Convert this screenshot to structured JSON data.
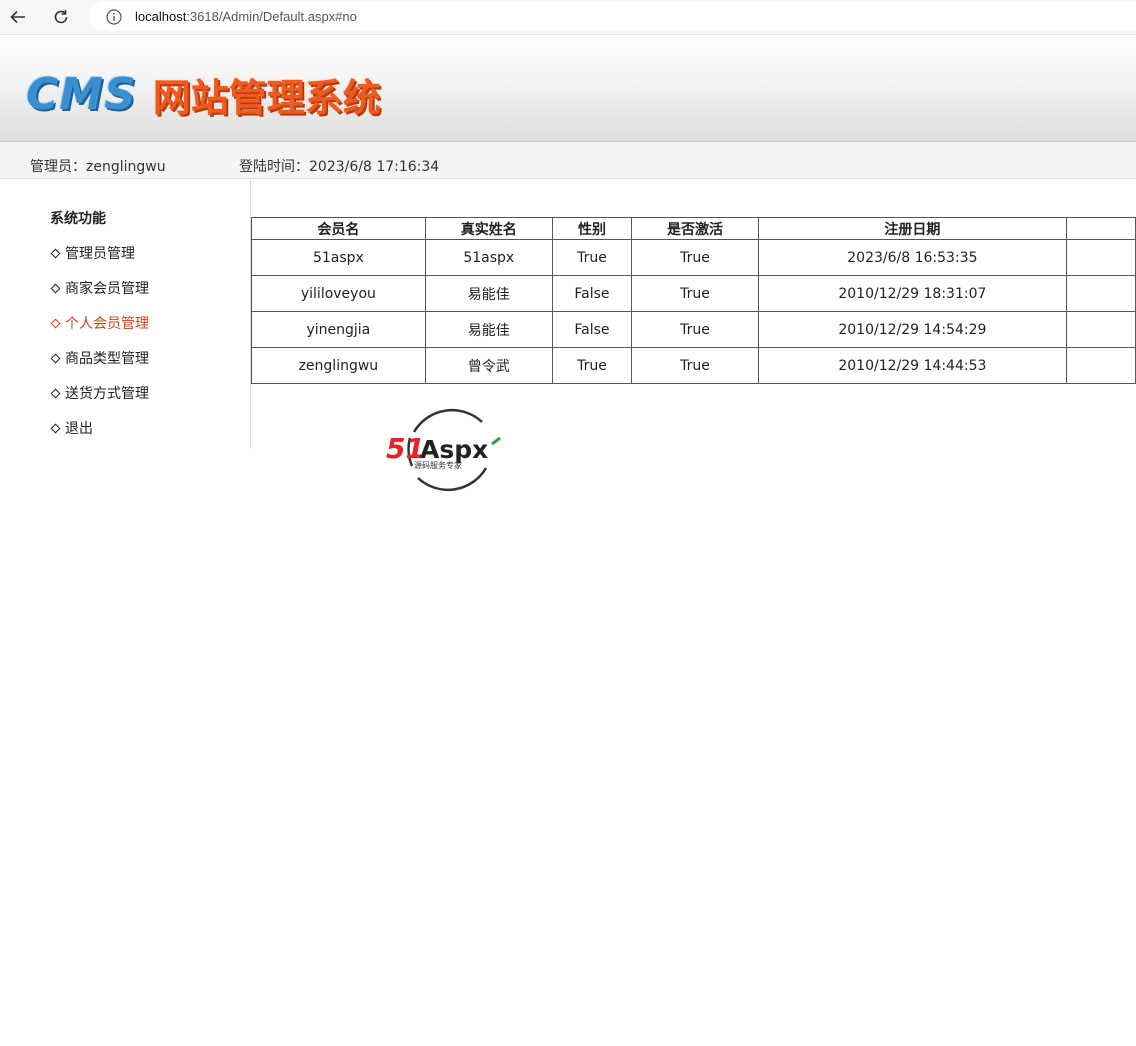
{
  "browser": {
    "url_host": "localhost",
    "url_rest": ":3618/Admin/Default.aspx#no"
  },
  "header": {
    "logo_cms": "CMS",
    "logo_title": "网站管理系统"
  },
  "infobar": {
    "admin": "管理员：zenglingwu",
    "login_time": "登陆时间：2023/6/8 17:16:34"
  },
  "sidebar": {
    "title": "系统功能",
    "items": [
      {
        "label": "管理员管理"
      },
      {
        "label": "商家会员管理"
      },
      {
        "label": "个人会员管理"
      },
      {
        "label": "商品类型管理"
      },
      {
        "label": "送货方式管理"
      },
      {
        "label": "退出"
      }
    ],
    "active_color": "#d4401a"
  },
  "table": {
    "headers": [
      "会员名",
      "真实姓名",
      "性别",
      "是否激活",
      "注册日期",
      ""
    ],
    "rows": [
      [
        "51aspx",
        "51aspx",
        "True",
        "True",
        "2023/6/8 16:53:35",
        ""
      ],
      [
        "yililoveyou",
        "易能佳",
        "False",
        "True",
        "2010/12/29 18:31:07",
        ""
      ],
      [
        "yinengjia",
        "易能佳",
        "False",
        "True",
        "2010/12/29 14:54:29",
        ""
      ],
      [
        "zenglingwu",
        "曾令武",
        "True",
        "True",
        "2010/12/29 14:44:53",
        ""
      ]
    ]
  },
  "watermark": {
    "brand_51": "51",
    "brand_aspx": "Aspx",
    "tagline": "源码服务专家"
  }
}
